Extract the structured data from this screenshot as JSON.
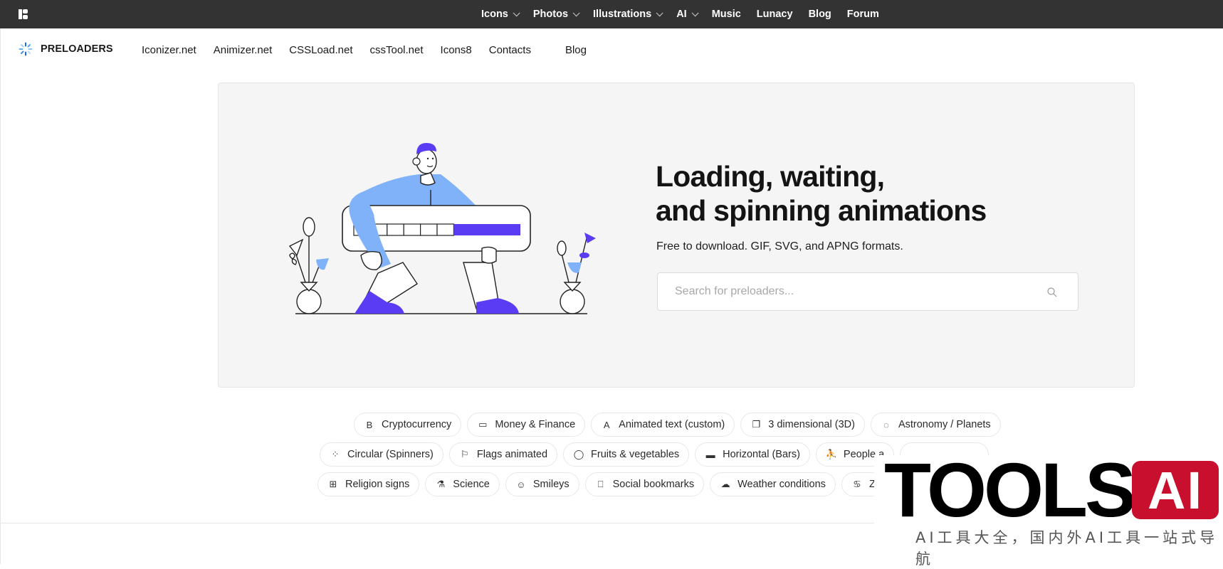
{
  "topbar": {
    "logo_icon": "icons8-logo-icon",
    "items": [
      {
        "label": "Icons",
        "dropdown": true
      },
      {
        "label": "Photos",
        "dropdown": true
      },
      {
        "label": "Illustrations",
        "dropdown": true
      },
      {
        "label": "AI",
        "dropdown": true
      },
      {
        "label": "Music",
        "dropdown": false
      },
      {
        "label": "Lunacy",
        "dropdown": false
      },
      {
        "label": "Blog",
        "dropdown": false
      },
      {
        "label": "Forum",
        "dropdown": false
      }
    ]
  },
  "subnav": {
    "brand": "PRELOADERS",
    "brand_icon": "spinner-icon",
    "links": [
      "Iconizer.net",
      "Animizer.net",
      "CSSLoad.net",
      "cssTool.net",
      "Icons8",
      "Contacts",
      "Blog"
    ]
  },
  "hero": {
    "headline_line1": "Loading, waiting,",
    "headline_line2": "and spinning animations",
    "subtitle": "Free to download. GIF, SVG, and APNG formats.",
    "search_placeholder": "Search for preloaders...",
    "search_value": "",
    "illustration_progress": 0.4,
    "colors": {
      "accent": "#5b3cf5",
      "light_blue": "#80b2fa",
      "panel_bg": "#f5f5f5"
    }
  },
  "categories": {
    "rows": [
      [
        {
          "icon": "bitcoin-icon",
          "glyph": "B",
          "label": "Cryptocurrency"
        },
        {
          "icon": "money-icon",
          "glyph": "▭",
          "label": "Money & Finance"
        },
        {
          "icon": "text-icon",
          "glyph": "A",
          "label": "Animated text (custom)"
        },
        {
          "icon": "cube-3d-icon",
          "glyph": "❐",
          "label": "3 dimensional (3D)"
        },
        {
          "icon": "planet-icon",
          "glyph": "◌",
          "label": "Astronomy / Planets"
        }
      ],
      [
        {
          "icon": "spinner-icon",
          "glyph": "⁘",
          "label": "Circular (Spinners)"
        },
        {
          "icon": "flag-icon",
          "glyph": "⚐",
          "label": "Flags animated"
        },
        {
          "icon": "apple-icon",
          "glyph": "◯",
          "label": "Fruits & vegetables"
        },
        {
          "icon": "battery-bar-icon",
          "glyph": "▬",
          "label": "Horizontal (Bars)"
        },
        {
          "icon": "person-running-icon",
          "glyph": "⛹",
          "label": "People a"
        },
        {
          "icon": "",
          "glyph": "",
          "label": ""
        }
      ],
      [
        {
          "icon": "religion-book-icon",
          "glyph": "⊞",
          "label": "Religion signs"
        },
        {
          "icon": "microscope-icon",
          "glyph": "⚗",
          "label": "Science"
        },
        {
          "icon": "smiley-icon",
          "glyph": "☺",
          "label": "Smileys"
        },
        {
          "icon": "bookmark-icon",
          "glyph": "⎕",
          "label": "Social bookmarks"
        },
        {
          "icon": "cloud-lightning-icon",
          "glyph": "☁",
          "label": "Weather conditions"
        },
        {
          "icon": "zodiac-icon",
          "glyph": "♋",
          "label": "Zoc"
        }
      ]
    ]
  },
  "watermark": {
    "brand_text": "TOOLS",
    "brand_badge": "AI",
    "tagline": "AI工具大全，国内外AI工具一站式导航",
    "badge_color": "#c8102e"
  }
}
